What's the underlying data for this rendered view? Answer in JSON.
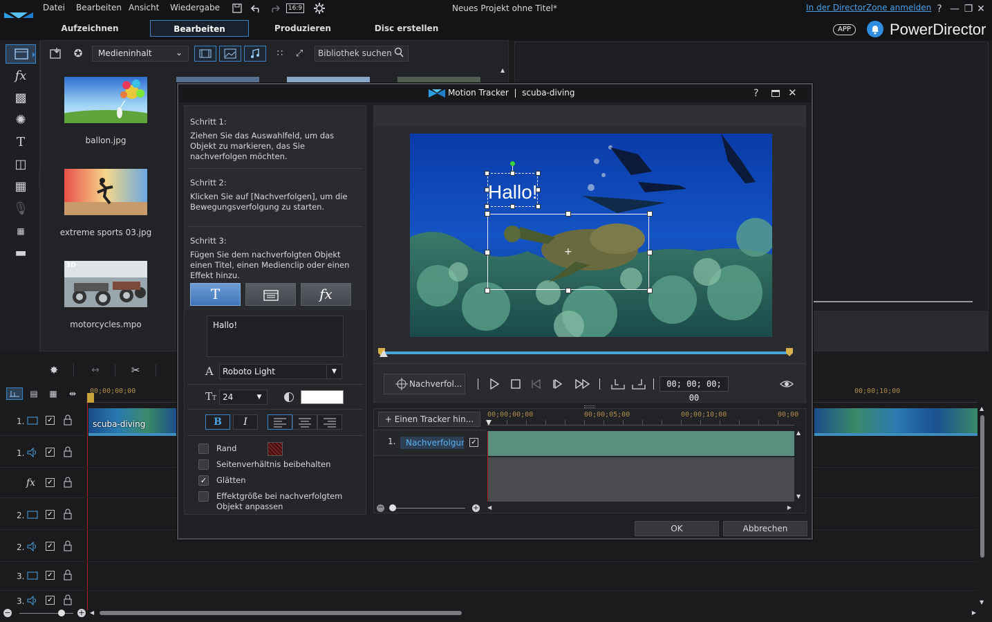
{
  "titlebar": {
    "menus": [
      "Datei",
      "Bearbeiten",
      "Ansicht",
      "Wiedergabe"
    ],
    "ratio": "16:9",
    "project_title": "Neues Projekt ohne Titel*",
    "directorzone_link": "In der DirectorZone anmelden",
    "help": "?"
  },
  "modes": {
    "tabs": [
      "Aufzeichnen",
      "Bearbeiten",
      "Produzieren",
      "Disc erstellen"
    ],
    "active": "Bearbeiten",
    "app_badge": "APP",
    "brand": "PowerDirector"
  },
  "library": {
    "media_select": "Medieninhalt",
    "search_placeholder": "Bibliothek suchen",
    "items": [
      {
        "name": "ballon.jpg"
      },
      {
        "name": "extreme sports 03.jpg"
      },
      {
        "name": "motorcycles.mpo",
        "badge": "3D"
      }
    ]
  },
  "timeline": {
    "ruler_start": "00;00;00;00",
    "ruler_end": "00;00;10;00",
    "clip_name": "scuba-diving",
    "tracks": [
      {
        "num": "1.",
        "type": "video"
      },
      {
        "num": "1.",
        "type": "audio"
      },
      {
        "num": "",
        "type": "fx"
      },
      {
        "num": "2.",
        "type": "video"
      },
      {
        "num": "2.",
        "type": "audio"
      },
      {
        "num": "3.",
        "type": "video"
      },
      {
        "num": "3.",
        "type": "audio"
      }
    ]
  },
  "dialog": {
    "title": "Motion Tracker",
    "clip": "scuba-diving",
    "help": "?",
    "step1_title": "Schritt 1:",
    "step1_text": "Ziehen Sie das Auswahlfeld, um das Objekt zu markieren, das Sie nachverfolgen möchten.",
    "step2_title": "Schritt 2:",
    "step2_text": "Klicken Sie auf [Nachverfolgen], um die Bewegungsverfolgung zu starten.",
    "step3_title": "Schritt 3:",
    "step3_text": "Fügen Sie dem nachverfolgten Objekt einen Titel, einen Medienclip oder einen Effekt hinzu.",
    "title_text": "Hallo!",
    "font": "Roboto Light",
    "font_size": "24",
    "bold": "B",
    "italic": "I",
    "checkboxes": [
      {
        "label": "Rand",
        "checked": false
      },
      {
        "label": "Seitenverhältnis beibehalten",
        "checked": false
      },
      {
        "label": "Glätten",
        "checked": true
      },
      {
        "label": "Effektgröße bei nachverfolgtem Objekt anpassen",
        "checked": false
      }
    ],
    "overlay_text": "Hallo!",
    "track_button": "Nachverfol...",
    "timecode": "00; 00; 00; 00",
    "add_tracker": "Einen Tracker hin...",
    "ruler": [
      "00;00;00;00",
      "00;00;05;00",
      "00;00;10;00",
      "00;00"
    ],
    "tracker_num": "1.",
    "tracker_name": "Nachverfolgung",
    "ok": "OK",
    "cancel": "Abbrechen"
  }
}
